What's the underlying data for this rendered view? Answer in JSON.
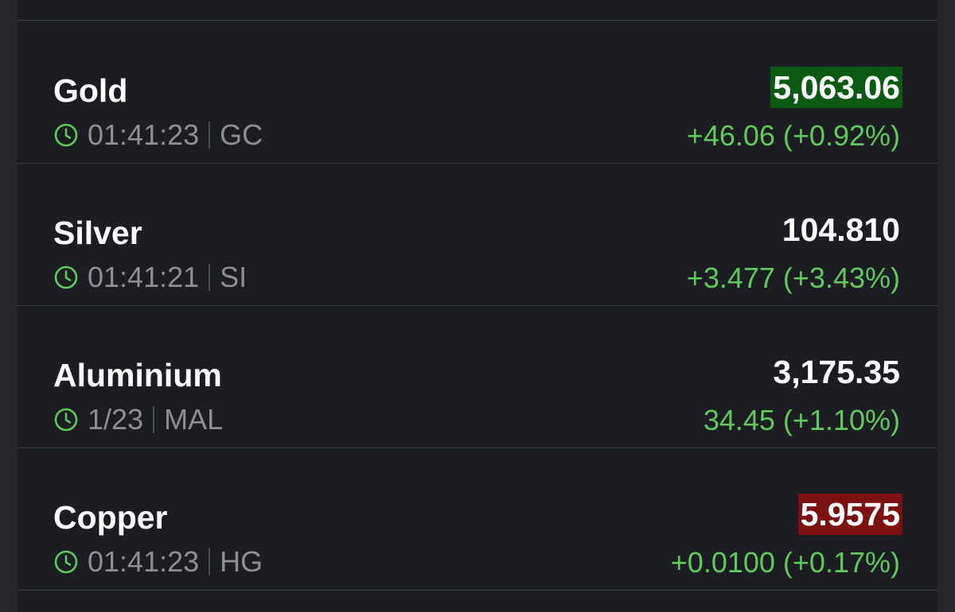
{
  "colors": {
    "background": "#1b1d22",
    "positive": "#5fc95b",
    "flash_up": "#0b5a12",
    "flash_down": "#7d1010",
    "muted_text": "#8e8e93"
  },
  "quotes": [
    {
      "name": "Gold",
      "time": "01:41:23",
      "symbol": "GC",
      "price": "5,063.06",
      "change": "+46.06 (+0.92%)",
      "price_flash": "up",
      "time_icon": "clock-icon"
    },
    {
      "name": "Silver",
      "time": "01:41:21",
      "symbol": "SI",
      "price": "104.810",
      "change": "+3.477 (+3.43%)",
      "price_flash": "none",
      "time_icon": "clock-icon"
    },
    {
      "name": "Aluminium",
      "time": "1/23",
      "symbol": "MAL",
      "price": "3,175.35",
      "change": "34.45 (+1.10%)",
      "price_flash": "none",
      "time_icon": "clock-icon"
    },
    {
      "name": "Copper",
      "time": "01:41:23",
      "symbol": "HG",
      "price": "5.9575",
      "change": "+0.0100 (+0.17%)",
      "price_flash": "down",
      "time_icon": "clock-icon"
    }
  ]
}
